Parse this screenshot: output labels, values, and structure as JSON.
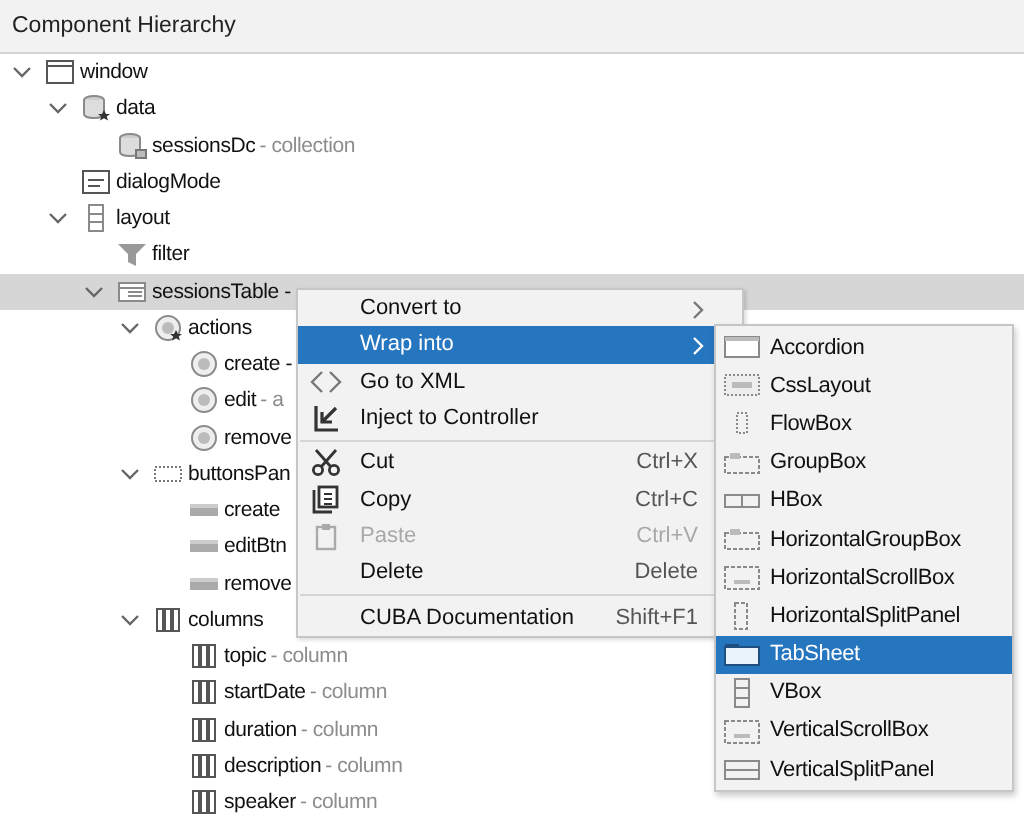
{
  "panel": {
    "title": "Component Hierarchy"
  },
  "tree": [
    {
      "label": "window",
      "kind": "window",
      "expanded": true,
      "selected": false,
      "children": [
        {
          "label": "data",
          "kind": "data",
          "expanded": true,
          "selected": false,
          "children": [
            {
              "label": "sessionsDc",
              "suffix": "- collection",
              "kind": "collection",
              "selected": false
            }
          ]
        },
        {
          "label": "dialogMode",
          "kind": "dialog",
          "selected": false
        },
        {
          "label": "layout",
          "kind": "layout",
          "expanded": true,
          "selected": false,
          "children": [
            {
              "label": "filter",
              "kind": "filter",
              "selected": false
            },
            {
              "label": "sessionsTable -",
              "kind": "table",
              "expanded": true,
              "selected": true,
              "children": [
                {
                  "label": "actions",
                  "kind": "actions",
                  "expanded": true,
                  "selected": false,
                  "children": [
                    {
                      "label": "create -",
                      "kind": "action",
                      "selected": false
                    },
                    {
                      "label": "edit",
                      "suffix": "- a",
                      "kind": "action",
                      "selected": false
                    },
                    {
                      "label": "remove",
                      "kind": "action",
                      "selected": false
                    }
                  ]
                },
                {
                  "label": "buttonsPan",
                  "kind": "panel",
                  "expanded": true,
                  "selected": false,
                  "children": [
                    {
                      "label": "create",
                      "kind": "button",
                      "selected": false
                    },
                    {
                      "label": "editBtn",
                      "kind": "button",
                      "selected": false
                    },
                    {
                      "label": "remove",
                      "kind": "button",
                      "selected": false
                    }
                  ]
                },
                {
                  "label": "columns",
                  "kind": "columns",
                  "expanded": true,
                  "selected": false,
                  "children": [
                    {
                      "label": "topic",
                      "suffix": "- column",
                      "kind": "column",
                      "selected": false
                    },
                    {
                      "label": "startDate",
                      "suffix": "- column",
                      "kind": "column",
                      "selected": false
                    },
                    {
                      "label": "duration",
                      "suffix": "- column",
                      "kind": "column",
                      "selected": false
                    },
                    {
                      "label": "description",
                      "suffix": "- column",
                      "kind": "column",
                      "selected": false
                    },
                    {
                      "label": "speaker",
                      "suffix": "- column",
                      "kind": "column",
                      "selected": false
                    }
                  ]
                }
              ]
            }
          ]
        }
      ]
    }
  ],
  "context_menu": {
    "groups": [
      [
        {
          "label": "Convert to",
          "submenu": true,
          "disabled": false,
          "selected": false
        },
        {
          "label": "Wrap into",
          "submenu": true,
          "disabled": false,
          "selected": true
        },
        {
          "label": "Go to XML",
          "submenu": false,
          "disabled": false,
          "selected": false
        },
        {
          "label": "Inject to Controller",
          "submenu": false,
          "disabled": false,
          "selected": false
        }
      ],
      [
        {
          "label": "Cut",
          "shortcut": "Ctrl+X",
          "submenu": false,
          "disabled": false,
          "selected": false
        },
        {
          "label": "Copy",
          "shortcut": "Ctrl+C",
          "submenu": false,
          "disabled": false,
          "selected": false
        },
        {
          "label": "Paste",
          "shortcut": "Ctrl+V",
          "submenu": false,
          "disabled": true,
          "selected": false
        },
        {
          "label": "Delete",
          "shortcut": "Delete",
          "submenu": false,
          "disabled": false,
          "selected": false
        }
      ],
      [
        {
          "label": "CUBA Documentation",
          "shortcut": "Shift+F1",
          "submenu": false,
          "disabled": false,
          "selected": false
        }
      ]
    ]
  },
  "submenu": {
    "items": [
      {
        "label": "Accordion",
        "kind": "accordion",
        "selected": false
      },
      {
        "label": "CssLayout",
        "kind": "css",
        "selected": false
      },
      {
        "label": "FlowBox",
        "kind": "flow",
        "selected": false
      },
      {
        "label": "GroupBox",
        "kind": "group",
        "selected": false
      },
      {
        "label": "HBox",
        "kind": "hbox",
        "selected": false
      },
      {
        "label": "HorizontalGroupBox",
        "kind": "group",
        "selected": false
      },
      {
        "label": "HorizontalScrollBox",
        "kind": "scroll",
        "selected": false
      },
      {
        "label": "HorizontalSplitPanel",
        "kind": "hsplit",
        "selected": false
      },
      {
        "label": "TabSheet",
        "kind": "tabsheet",
        "selected": true
      },
      {
        "label": "VBox",
        "kind": "vbox",
        "selected": false
      },
      {
        "label": "VerticalScrollBox",
        "kind": "scroll",
        "selected": false
      },
      {
        "label": "VerticalSplitPanel",
        "kind": "vsplit",
        "selected": false
      }
    ]
  }
}
